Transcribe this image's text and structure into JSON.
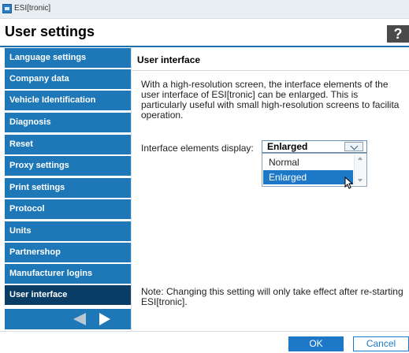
{
  "window": {
    "app_title": "ESI[tronic]"
  },
  "header": {
    "title": "User settings",
    "help_label": "?"
  },
  "sidebar": {
    "items": [
      {
        "label": "Language settings"
      },
      {
        "label": "Company data"
      },
      {
        "label": "Vehicle Identification"
      },
      {
        "label": "Diagnosis"
      },
      {
        "label": "Reset"
      },
      {
        "label": "Proxy settings"
      },
      {
        "label": "Print settings"
      },
      {
        "label": "Protocol"
      },
      {
        "label": "Units"
      },
      {
        "label": "Partnershop"
      },
      {
        "label": "Manufacturer logins"
      },
      {
        "label": "User interface",
        "active": true
      }
    ],
    "pager": {
      "prev_icon": "triangle-left-icon",
      "next_icon": "triangle-right-icon"
    }
  },
  "main": {
    "section_title": "User interface",
    "description": "With a high-resolution screen, the interface elements of the\nuser interface of ESI[tronic] can be enlarged. This is\nparticularly useful with small high-resolution screens to facilita\noperation.",
    "field_label": "Interface elements display:",
    "select": {
      "value": "Enlarged",
      "options": [
        "Normal",
        "Enlarged"
      ],
      "selected": "Enlarged"
    },
    "note": "Note: Changing this setting will only take effect after re-starting\nESI[tronic]."
  },
  "footer": {
    "ok_label": "OK",
    "cancel_label": "Cancel"
  },
  "colors": {
    "accent": "#1e78b8",
    "active_nav": "#0a3d66",
    "selection": "#1e78c8"
  }
}
